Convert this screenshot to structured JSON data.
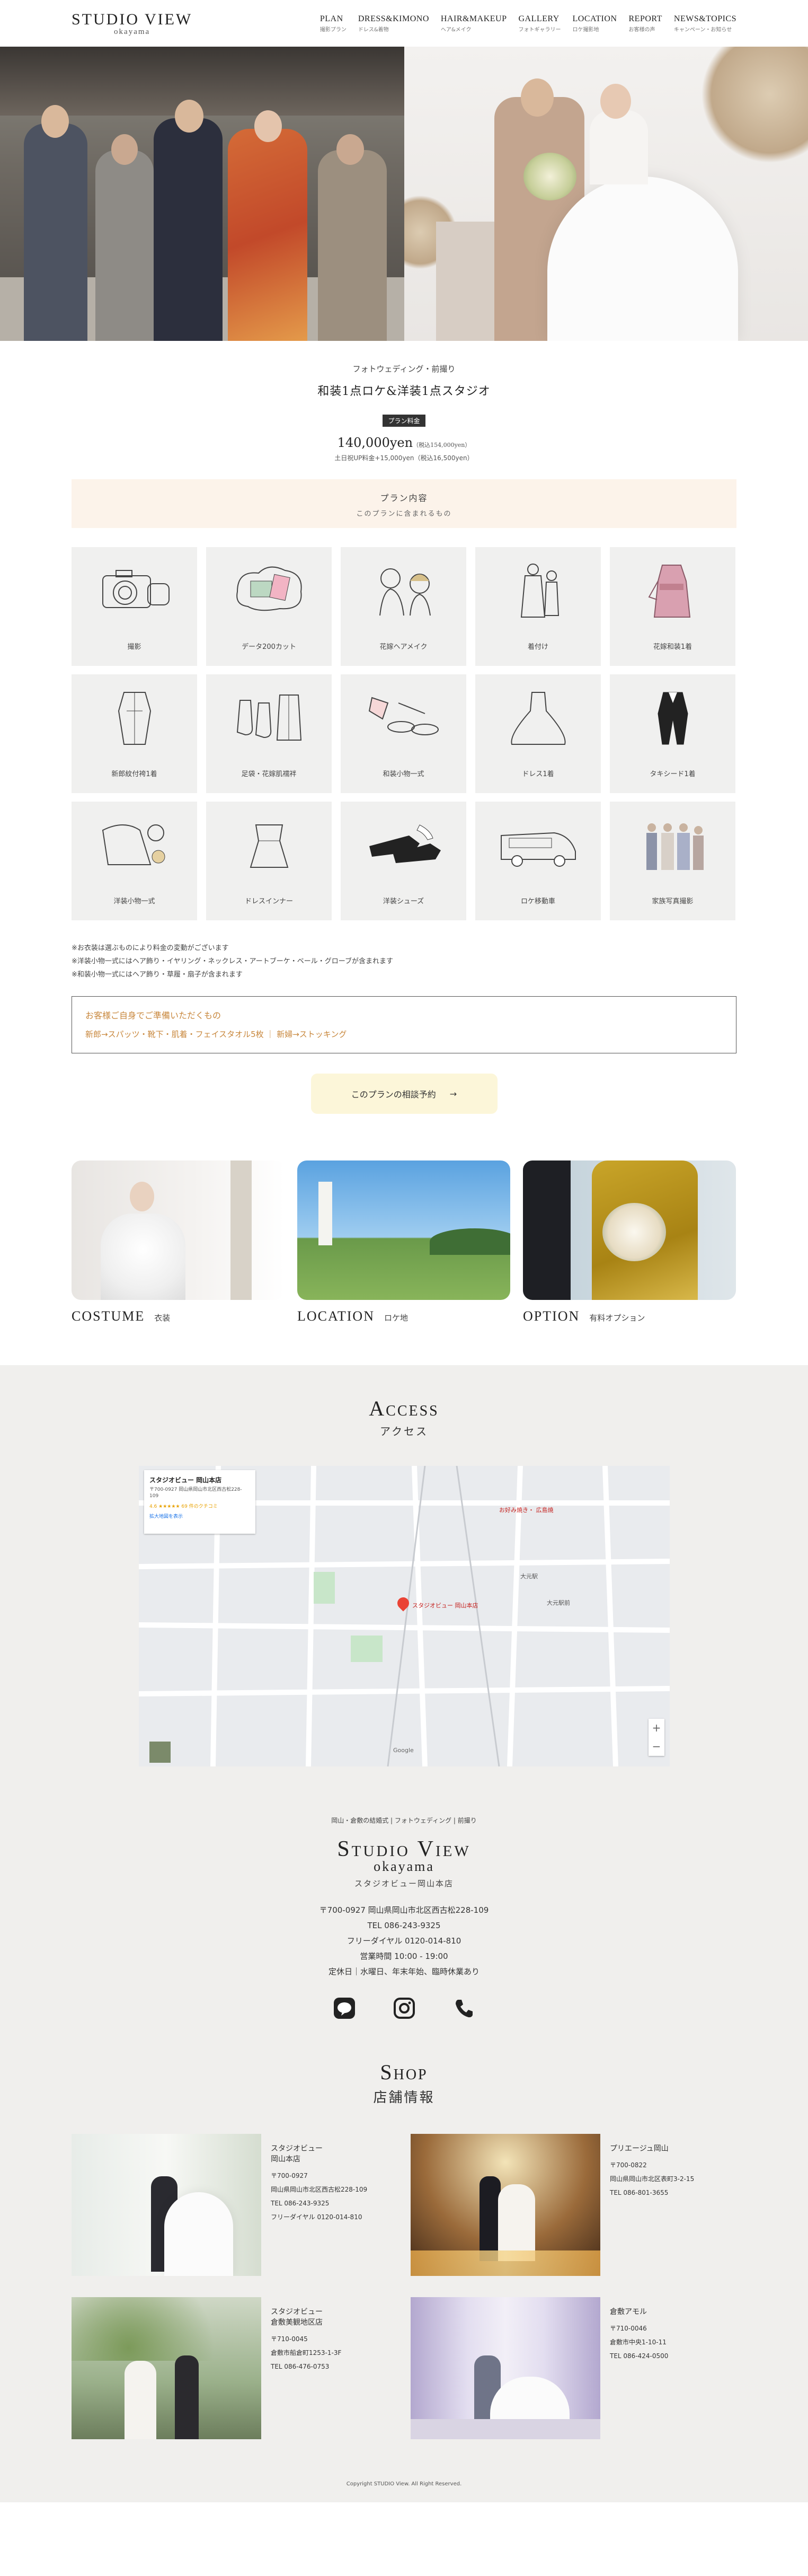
{
  "header": {
    "logo_main": "STUDIO VIEW",
    "logo_sub": "okayama",
    "nav": [
      {
        "en": "PLAN",
        "ja": "撮影プラン"
      },
      {
        "en": "DRESS&KIMONO",
        "ja": "ドレス&着物"
      },
      {
        "en": "HAIR&MAKEUP",
        "ja": "ヘア&メイク"
      },
      {
        "en": "GALLERY",
        "ja": "フォトギャラリー"
      },
      {
        "en": "LOCATION",
        "ja": "ロケ撮影地"
      },
      {
        "en": "REPORT",
        "ja": "お客様の声"
      },
      {
        "en": "NEWS&TOPICS",
        "ja": "キャンペーン・お知らせ"
      }
    ]
  },
  "plan": {
    "kicker": "フォトウェディング・前撮り",
    "title": "和装1点ロケ&洋装1点スタジオ",
    "badge": "プラン料金",
    "price": "140,000yen",
    "price_tax": "（税込154,000yen）",
    "extra": "土日祝UP料金+15,000yen（税込16,500yen）",
    "content_title": "プラン内容",
    "content_sub": "このプランに含まれるもの",
    "items": [
      {
        "label": "撮影",
        "icon": "camera-icon"
      },
      {
        "label": "データ200カット",
        "icon": "photo-data-icon"
      },
      {
        "label": "花嫁ヘアメイク",
        "icon": "hair-makeup-icon"
      },
      {
        "label": "着付け",
        "icon": "dressing-icon"
      },
      {
        "label": "花嫁和装1着",
        "icon": "bride-kimono-icon"
      },
      {
        "label": "新郎紋付袴1着",
        "icon": "groom-hakama-icon"
      },
      {
        "label": "足袋・花嫁肌襦袢",
        "icon": "tabi-icon"
      },
      {
        "label": "和装小物一式",
        "icon": "kimono-accessories-icon"
      },
      {
        "label": "ドレス1着",
        "icon": "dress-icon"
      },
      {
        "label": "タキシード1着",
        "icon": "tuxedo-icon"
      },
      {
        "label": "洋装小物一式",
        "icon": "western-accessories-icon"
      },
      {
        "label": "ドレスインナー",
        "icon": "dress-inner-icon"
      },
      {
        "label": "洋装シューズ",
        "icon": "shoes-icon"
      },
      {
        "label": "ロケ移動車",
        "icon": "van-icon"
      },
      {
        "label": "家族写真撮影",
        "icon": "family-photo-icon"
      }
    ],
    "notes": [
      "※お衣装は選ぶものにより料金の変動がございます",
      "※洋装小物一式にはヘア飾り・イヤリング・ネックレス・アートブーケ・ベール・グローブが含まれます",
      "※和装小物一式にはヘア飾り・草履・扇子が含まれます"
    ],
    "prep_title": "お客様ご自身でご準備いただくもの",
    "prep_items": "新郎→スパッツ・靴下・肌着・フェイスタオル5枚 ｜ 新婦→ストッキング",
    "cta": "このプランの相談予約",
    "cta_arrow": "→"
  },
  "cards": [
    {
      "en": "COSTUME",
      "ja": "衣装"
    },
    {
      "en": "LOCATION",
      "ja": "ロケ地"
    },
    {
      "en": "OPTION",
      "ja": "有料オプション"
    }
  ],
  "access": {
    "title_en": "Access",
    "title_ja": "アクセス",
    "map_name": "スタジオビュー 岡山本店",
    "map_addr": "〒700-0927 岡山県岡山市北区西古松228-109",
    "map_rating": "4.6 ★★★★★ 69 件のクチコミ",
    "map_link": "拡大地図を表示",
    "map_pin_label": "スタジオビュー 岡山本店",
    "map_labels": [
      "大元駅",
      "お好み焼き・ 広島焼",
      "大元駅前",
      "Google"
    ]
  },
  "studio": {
    "tag": "岡山・倉敷の結婚式 | フォトウェディング | 前撮り",
    "logo": "Studio View",
    "sub": "okayama",
    "ja": "スタジオビュー岡山本店",
    "lines": [
      "〒700-0927 岡山県岡山市北区西古松228-109",
      "TEL 086-243-9325",
      "フリーダイヤル 0120-014-810",
      "営業時間 10:00 - 19:00",
      "定休日｜水曜日、年末年始、臨時休業あり"
    ]
  },
  "shop": {
    "title_en": "Shop",
    "title_ja": "店舗情報",
    "list": [
      {
        "name": "スタジオビュー\n岡山本店",
        "details": [
          "〒700-0927",
          "岡山県岡山市北区西古松228-109",
          "TEL 086-243-9325",
          "フリーダイヤル 0120-014-810"
        ]
      },
      {
        "name": "プリエージュ岡山",
        "details": [
          "〒700-0822",
          "岡山県岡山市北区表町3-2-15",
          "TEL 086-801-3655"
        ]
      },
      {
        "name": "スタジオビュー\n倉敷美観地区店",
        "details": [
          "〒710-0045",
          "倉敷市船倉町1253-1-3F",
          "TEL 086-476-0753"
        ]
      },
      {
        "name": "倉敷アモル",
        "details": [
          "〒710-0046",
          "倉敷市中央1-10-11",
          "TEL 086-424-0500"
        ]
      }
    ]
  },
  "footer": {
    "copyright": "Copyright STUDIO View. All Right Reserved."
  }
}
